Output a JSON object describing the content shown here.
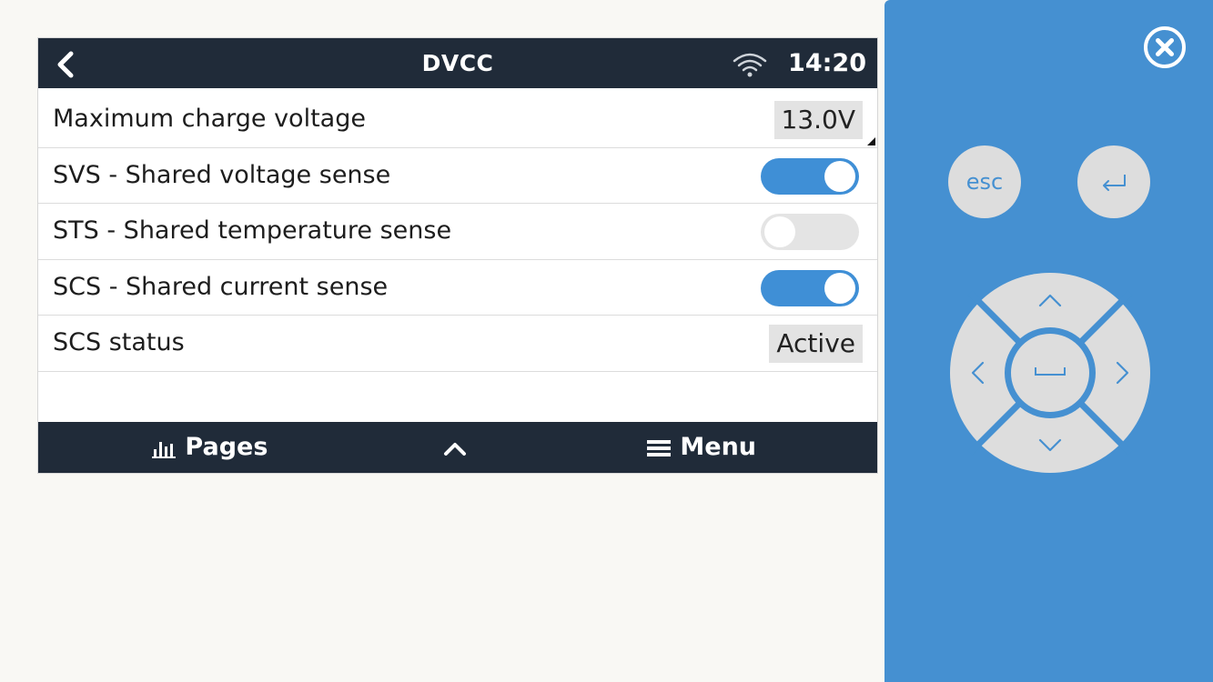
{
  "header": {
    "title": "DVCC",
    "time": "14:20"
  },
  "settings": {
    "max_charge_voltage": {
      "label": "Maximum charge voltage",
      "value": "13.0V"
    },
    "svs": {
      "label": "SVS - Shared voltage sense",
      "enabled": true
    },
    "sts": {
      "label": "STS - Shared temperature sense",
      "enabled": false
    },
    "scs": {
      "label": "SCS - Shared current sense",
      "enabled": true
    },
    "scs_status": {
      "label": "SCS status",
      "value": "Active"
    }
  },
  "footer": {
    "pages_label": "Pages",
    "menu_label": "Menu"
  },
  "controls": {
    "esc_label": "esc"
  },
  "icons": [
    "back-arrow-icon",
    "wifi-icon",
    "chart-icon",
    "chevron-up-icon",
    "hamburger-menu-icon",
    "close-icon",
    "enter-icon",
    "dpad-up-icon",
    "dpad-down-icon",
    "dpad-left-icon",
    "dpad-right-icon",
    "space-icon"
  ],
  "colors": {
    "bar_background": "#202b39",
    "accent_blue": "#3f8fd6",
    "panel_blue": "#4590d1",
    "button_gray": "#dddddd"
  }
}
